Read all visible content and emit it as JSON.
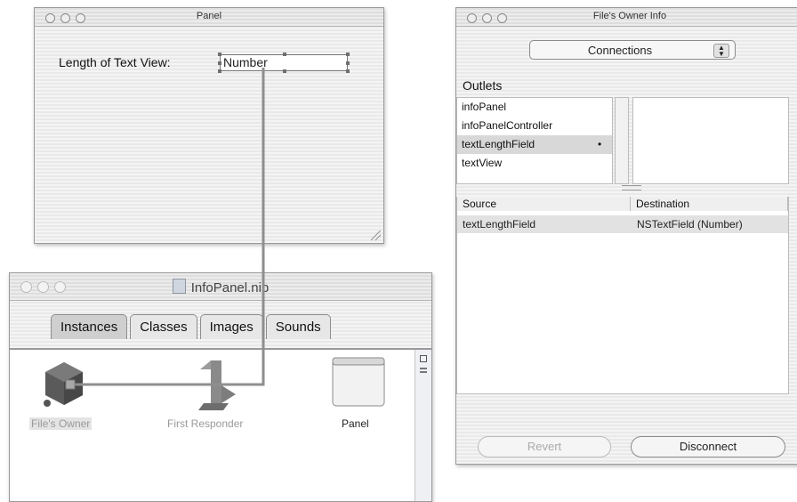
{
  "panel_window": {
    "title": "Panel",
    "label": "Length of Text View:",
    "field_value": "Number"
  },
  "nib_window": {
    "title": "InfoPanel.nib",
    "tabs": [
      "Instances",
      "Classes",
      "Images",
      "Sounds"
    ],
    "selected_tab": "Instances",
    "instances": [
      {
        "label": "File's Owner"
      },
      {
        "label": "First Responder"
      },
      {
        "label": "Panel"
      }
    ]
  },
  "info_window": {
    "title": "File's Owner Info",
    "popup_value": "Connections",
    "outlets_label": "Outlets",
    "outlets": [
      "infoPanel",
      "infoPanelController",
      "textLengthField",
      "textView"
    ],
    "selected_outlet": "textLengthField",
    "table": {
      "columns": [
        "Source",
        "Destination"
      ],
      "rows": [
        {
          "source": "textLengthField",
          "destination": "NSTextField (Number)"
        }
      ]
    },
    "buttons": {
      "revert": "Revert",
      "disconnect": "Disconnect"
    }
  }
}
